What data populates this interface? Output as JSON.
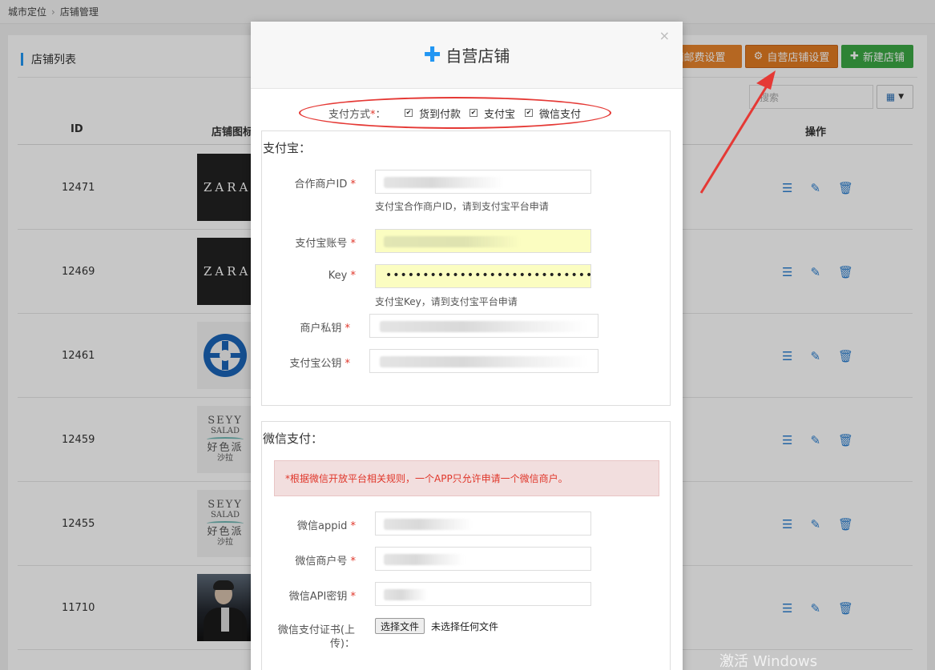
{
  "breadcrumb": {
    "item1": "城市定位",
    "item2": "店铺管理"
  },
  "panel": {
    "title": "店铺列表"
  },
  "toolbar": {
    "shipping_settings": "铺邮费设置",
    "self_store_settings": "自营店铺设置",
    "new_store": "新建店铺",
    "search_placeholder": "搜索"
  },
  "table": {
    "headers": {
      "id": "ID",
      "icon": "店铺图标",
      "ops": "操作"
    },
    "rows": [
      {
        "id": "12471",
        "logo": "ZARA"
      },
      {
        "id": "12469",
        "logo": "ZARA"
      },
      {
        "id": "12461",
        "logo": ""
      },
      {
        "id": "12459",
        "logo_lines": [
          "SEYY",
          "SALAD",
          "好色派",
          "沙拉"
        ]
      },
      {
        "id": "12455",
        "logo_lines": [
          "SEYY",
          "SALAD",
          "好色派",
          "沙拉"
        ]
      },
      {
        "id": "11710",
        "logo": ""
      }
    ]
  },
  "modal": {
    "title": "自营店铺",
    "payment_label": "支付方式",
    "payment_options": [
      "货到付款",
      "支付宝",
      "微信支付"
    ],
    "alipay": {
      "section_title": "支付宝：",
      "partner_id_label": "合作商户ID",
      "partner_id_help": "支付宝合作商户ID，请到支付宝平台申请",
      "account_label": "支付宝账号",
      "key_label": "Key",
      "key_value": "••••••••••••••••••••••••••••••••",
      "key_help": "支付宝Key，请到支付宝平台申请",
      "private_key_label": "商户私钥",
      "public_key_label": "支付宝公钥"
    },
    "wechat": {
      "section_title": "微信支付：",
      "alert": "*根据微信开放平台相关规则，一个APP只允许申请一个微信商户。",
      "appid_label": "微信appid",
      "merchant_no_label": "微信商户号",
      "api_key_label": "微信API密钥",
      "cert_label": "微信支付证书(上传)：",
      "choose_file": "选择文件",
      "no_file": "未选择任何文件"
    }
  },
  "watermark": "激活 Windows",
  "colors": {
    "accent": "#2196f3",
    "orange": "#e8842c",
    "green": "#3ca845",
    "required": "#e0362a",
    "annotation": "#e53935"
  }
}
